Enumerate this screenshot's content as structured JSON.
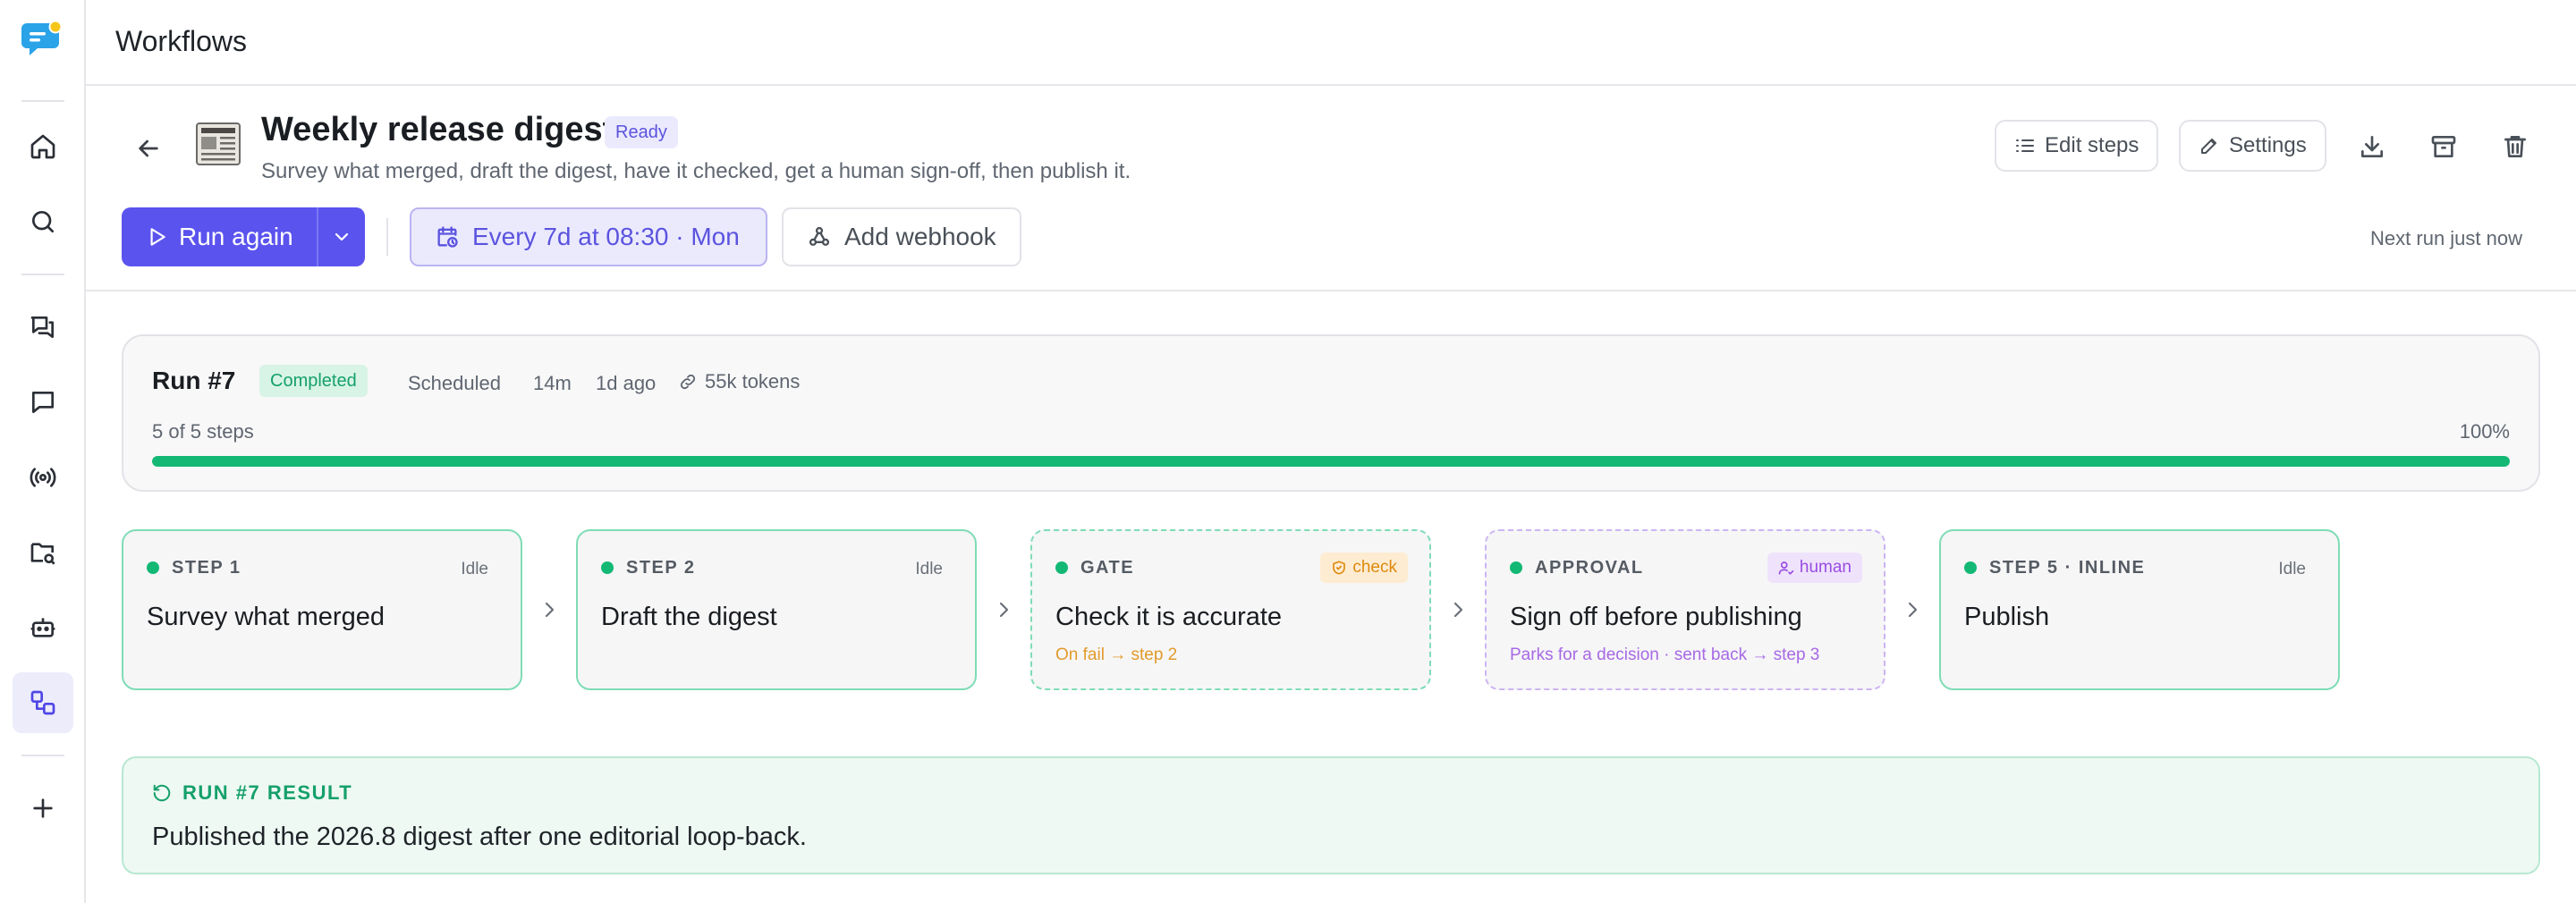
{
  "topbar": {
    "title": "Workflows"
  },
  "workflow": {
    "title": "Weekly release digest",
    "status": "Ready",
    "description": "Survey what merged, draft the digest, have it checked, get a human sign-off, then publish it."
  },
  "header_actions": {
    "edit_steps": "Edit steps",
    "settings": "Settings"
  },
  "controls": {
    "run_again": "Run again",
    "schedule": "Every 7d at 08:30 · Mon",
    "add_webhook": "Add webhook",
    "next_run": "Next run just now"
  },
  "run": {
    "id": "Run #7",
    "status": "Completed",
    "trigger": "Scheduled",
    "duration": "14m",
    "when": "1d ago",
    "tokens": "55k tokens",
    "steps_done": "5 of 5 steps",
    "progress_label": "100%",
    "progress": 1.0
  },
  "steps": [
    {
      "kind": "STEP 1",
      "state": "Idle",
      "title": "Survey what merged"
    },
    {
      "kind": "STEP 2",
      "state": "Idle",
      "title": "Draft the digest"
    },
    {
      "kind": "GATE",
      "tag": "check",
      "title": "Check it is accurate",
      "sub": "On fail → step 2"
    },
    {
      "kind": "APPROVAL",
      "tag": "human",
      "title": "Sign off before publishing",
      "sub": "Parks for a decision · sent back → step 3"
    },
    {
      "kind": "STEP 5 · INLINE",
      "state": "Idle",
      "title": "Publish"
    }
  ],
  "result": {
    "heading": "RUN #7 RESULT",
    "text": "Published the 2026.8 digest after one editorial loop-back."
  },
  "colors": {
    "accent": "#5b53ee",
    "success": "#13b875",
    "warning": "#dd8a0f",
    "human": "#9a4de2"
  },
  "icons": {
    "sidebar": [
      "home-icon",
      "search-icon",
      "chats-icon",
      "message-icon",
      "broadcast-icon",
      "folder-icon",
      "bot-icon",
      "workflow-icon",
      "plus-icon"
    ]
  }
}
